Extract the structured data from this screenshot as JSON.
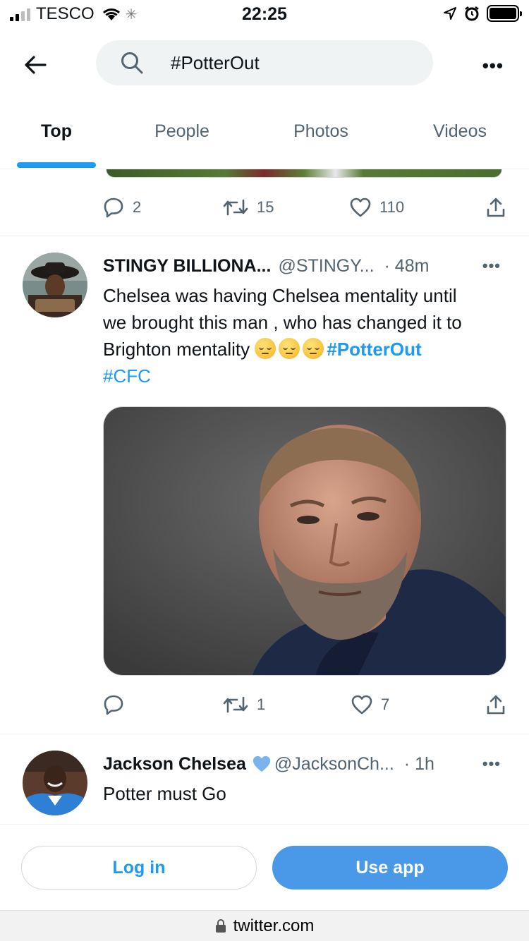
{
  "status_bar": {
    "carrier": "TESCO",
    "time": "22:25"
  },
  "search": {
    "query": "#PotterOut"
  },
  "tabs": [
    {
      "label": "Top"
    },
    {
      "label": "People"
    },
    {
      "label": "Photos"
    },
    {
      "label": "Videos"
    }
  ],
  "prev_tweet": {
    "replies": "2",
    "retweets": "15",
    "likes": "110"
  },
  "tweets": [
    {
      "name": "STINGY BILLIONA...",
      "handle": "@STINGY...",
      "time": "· 48m",
      "text_lines": [
        "Chelsea was having Chelsea mentality until",
        "we brought this man , who has changed it to",
        "Brighton mentality "
      ],
      "emoji_alt": "😔😔😔",
      "hashtags": [
        "#PotterOut",
        "#CFC"
      ],
      "replies": "",
      "retweets": "1",
      "likes": "7"
    },
    {
      "name": "Jackson Chelsea",
      "handle": "@JacksonCh...",
      "time": "· 1h",
      "text": "Potter must Go"
    }
  ],
  "bottom": {
    "login_label": "Log in",
    "app_label": "Use app"
  },
  "browser": {
    "url": "twitter.com"
  },
  "colors": {
    "accent": "#1d9bf0",
    "use_app_bg": "#4a99e9",
    "secondary_text": "#536471"
  }
}
